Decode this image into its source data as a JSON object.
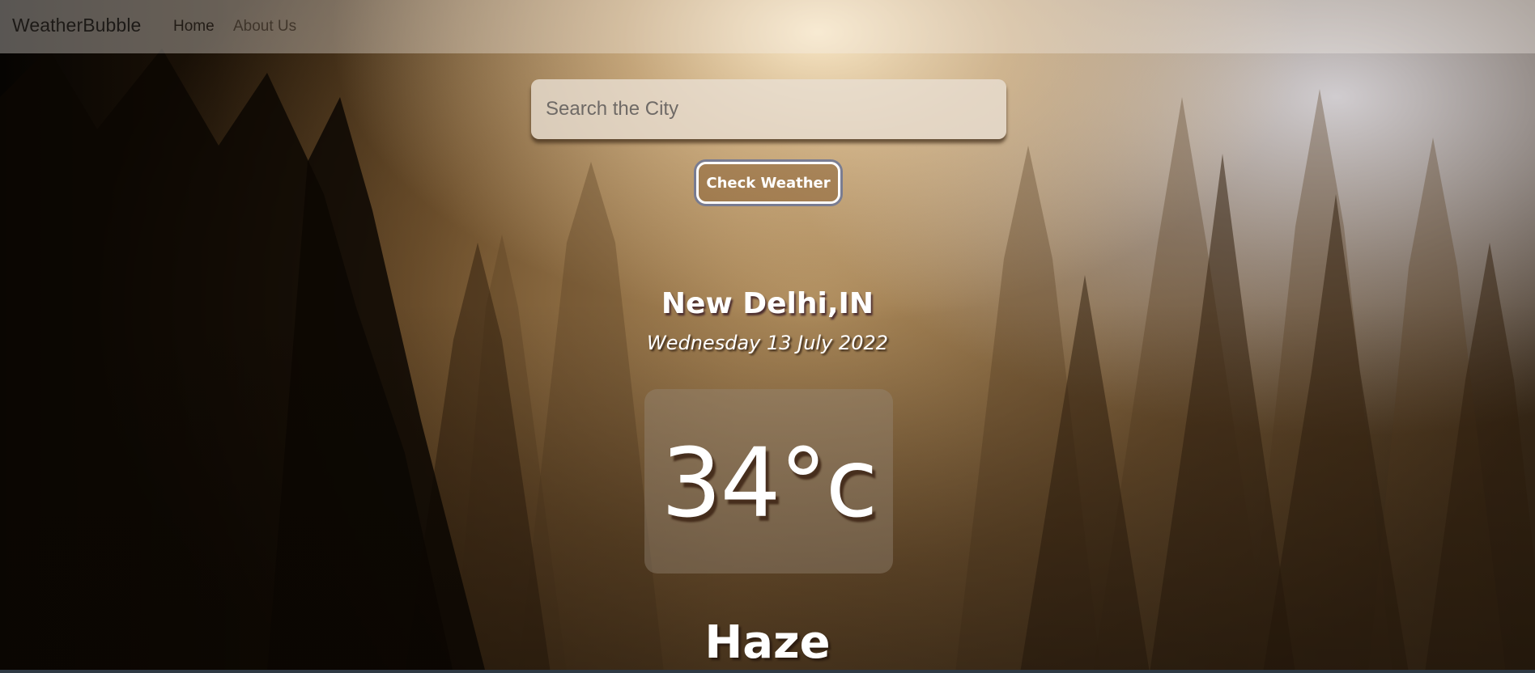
{
  "navbar": {
    "brand": "WeatherBubble",
    "links": [
      {
        "label": "Home",
        "active": true
      },
      {
        "label": "About Us",
        "active": false
      }
    ]
  },
  "search": {
    "placeholder": "Search the City",
    "value": "",
    "button_label": "Check Weather"
  },
  "weather": {
    "city": "New Delhi,IN",
    "date": "Wednesday 13 July 2022",
    "temperature": "34°c",
    "condition": "Haze"
  },
  "colors": {
    "text": "#ffffff",
    "brand_text": "#1d1a17",
    "button_ring": "#6c7696"
  },
  "background": {
    "theme": "misty forest sunrise"
  }
}
